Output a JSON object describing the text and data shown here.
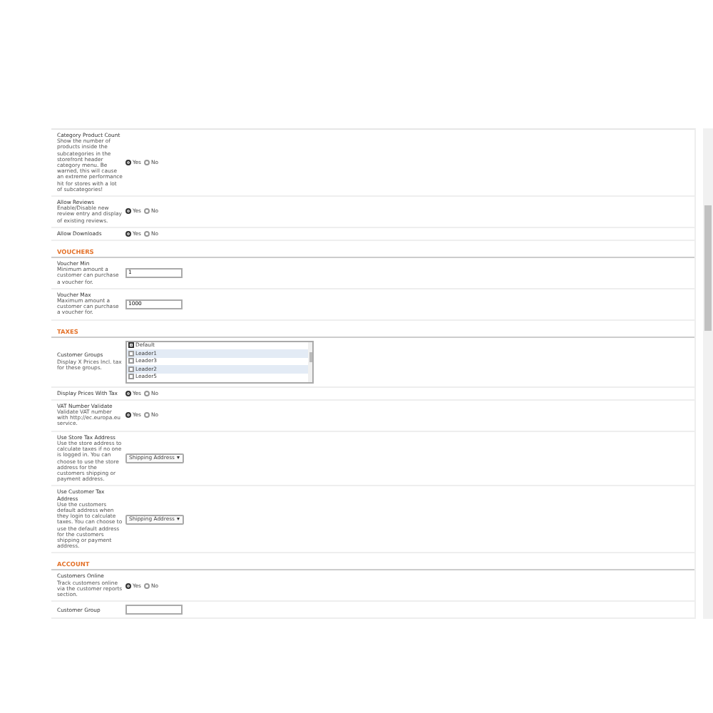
{
  "sections": [
    {
      "rows": [
        {
          "kind": "radio",
          "label": "Category Product Count",
          "help": "Show the number of products inside the subcategories in the storefront header category menu. Be warned, this will cause an extreme performance hit for stores with a lot of subcategories!",
          "options": [
            {
              "label": "Yes",
              "selected": true
            },
            {
              "label": "No",
              "selected": false
            }
          ]
        },
        {
          "kind": "radio",
          "label": "Allow Reviews",
          "help": "Enable/Disable new review entry and display of existing reviews.",
          "options": [
            {
              "label": "Yes",
              "selected": true
            },
            {
              "label": "No",
              "selected": false
            }
          ]
        },
        {
          "kind": "radio",
          "label": "Allow Downloads",
          "options": [
            {
              "label": "Yes",
              "selected": true
            },
            {
              "label": "No",
              "selected": false
            }
          ]
        }
      ]
    },
    {
      "heading": "VOUCHERS",
      "rows": [
        {
          "kind": "text",
          "label": "Voucher Min",
          "help": "Minimum amount a customer can purchase a voucher for.",
          "value": "1"
        },
        {
          "kind": "text",
          "label": "Voucher Max",
          "help": "Maximum amount a customer can purchase a voucher for.",
          "value": "1000"
        }
      ]
    },
    {
      "heading": "TAXES",
      "rows": [
        {
          "kind": "checklist",
          "label": "Customer Groups",
          "help": "Display X Prices Incl. tax for these groups.",
          "items": [
            {
              "label": "Default",
              "checked": true,
              "shaded": false
            },
            {
              "label": "Leader1",
              "checked": false,
              "shaded": true
            },
            {
              "label": "Leader3",
              "checked": false,
              "shaded": false
            },
            {
              "label": "Leader2",
              "checked": false,
              "shaded": true
            },
            {
              "label": "Leader5",
              "checked": false,
              "shaded": false
            }
          ]
        },
        {
          "kind": "radio",
          "label": "Display Prices With Tax",
          "options": [
            {
              "label": "Yes",
              "selected": true
            },
            {
              "label": "No",
              "selected": false
            }
          ]
        },
        {
          "kind": "radio",
          "label": "VAT Number Validate",
          "help": "Validate VAT number with http://ec.europa.eu service.",
          "options": [
            {
              "label": "Yes",
              "selected": true
            },
            {
              "label": "No",
              "selected": false
            }
          ]
        },
        {
          "kind": "select",
          "label": "Use Store Tax Address",
          "help": "Use the store address to calculate taxes if no one is logged in. You can choose to use the store address for the customers shipping or payment address.",
          "value": "Shipping Address"
        },
        {
          "kind": "select",
          "label": "Use Customer Tax Address",
          "help": "Use the customers default address when they login to calculate taxes. You can choose to use the default address for the customers shipping or payment address.",
          "value": "Shipping Address"
        }
      ]
    },
    {
      "heading": "ACCOUNT",
      "rows": [
        {
          "kind": "radio",
          "label": "Customers Online",
          "help": "Track customers online via the customer reports section.",
          "options": [
            {
              "label": "Yes",
              "selected": true
            },
            {
              "label": "No",
              "selected": false
            }
          ]
        },
        {
          "kind": "text",
          "label": "Customer Group"
        }
      ]
    }
  ]
}
